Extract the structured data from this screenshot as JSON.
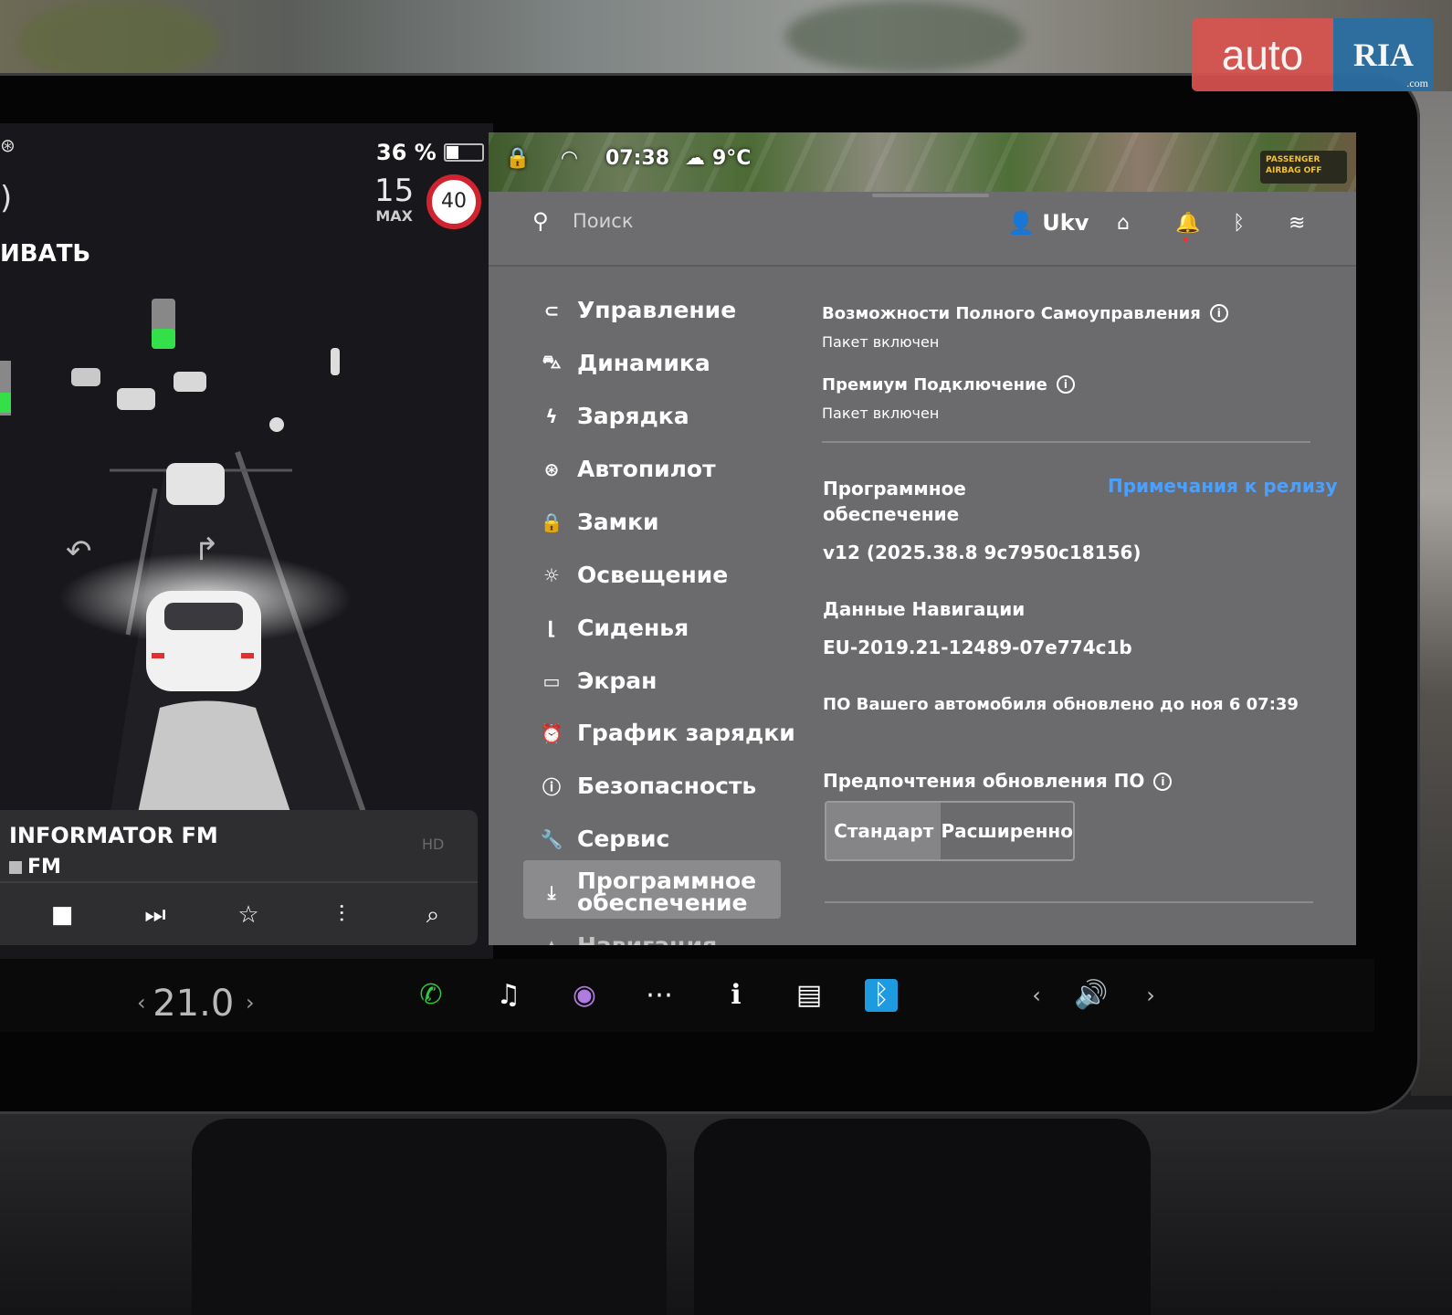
{
  "watermark": {
    "left": "auto",
    "right": "RIA",
    "suffix": ".com"
  },
  "driving": {
    "battery_percent": "36 %",
    "battery_level": 0.36,
    "speed_value": "15",
    "speed_unit": "MAX",
    "speed_limit": "40",
    "partial_text": "ИВАТЬ"
  },
  "media": {
    "station": "INFORMATOR FM",
    "band": "FM",
    "hd_label": "HD"
  },
  "statusbar": {
    "time": "07:38",
    "temperature": "9°C",
    "airbag_line1": "PASSENGER",
    "airbag_line2": "AIRBAG OFF"
  },
  "search": {
    "placeholder": "Поиск"
  },
  "user": {
    "name": "Ukv"
  },
  "menu": [
    {
      "label": "Управление",
      "icon": "toggle-icon"
    },
    {
      "label": "Динамика",
      "icon": "car-icon"
    },
    {
      "label": "Зарядка",
      "icon": "bolt-icon"
    },
    {
      "label": "Автопилот",
      "icon": "steering-wheel-icon"
    },
    {
      "label": "Замки",
      "icon": "lock-icon"
    },
    {
      "label": "Освещение",
      "icon": "sun-icon"
    },
    {
      "label": "Сиденья",
      "icon": "seat-icon"
    },
    {
      "label": "Экран",
      "icon": "display-icon"
    },
    {
      "label": "График зарядки",
      "icon": "alarm-clock-icon"
    },
    {
      "label": "Безопасность",
      "icon": "alert-circle-icon"
    },
    {
      "label": "Сервис",
      "icon": "wrench-icon"
    },
    {
      "label": "Программное обеспечение",
      "icon": "download-icon"
    },
    {
      "label": "Навигация",
      "icon": "navigation-icon"
    }
  ],
  "software": {
    "fsd_title": "Возможности Полного Самоуправления",
    "fsd_status": "Пакет включен",
    "premium_title": "Премиум Подключение",
    "premium_status": "Пакет включен",
    "section_line1": "Программное",
    "section_line2": "обеспечение",
    "release_notes": "Примечания к релизу",
    "version": "v12 (2025.38.8 9c7950c18156)",
    "nav_data_title": "Данные Навигации",
    "nav_data_value": "EU-2019.21-12489-07e774c1b",
    "updated_text": "ПО Вашего автомобиля обновлено до ноя 6 07:39",
    "update_pref_title": "Предпочтения обновления ПО",
    "option_standard": "Стандарт",
    "option_advanced": "Расширенно"
  },
  "dock": {
    "temperature": "21.0"
  },
  "colors": {
    "accent_link": "#4aa0ff",
    "speed_limit_ring": "#d0232f",
    "phone_green": "#2ecc40"
  }
}
